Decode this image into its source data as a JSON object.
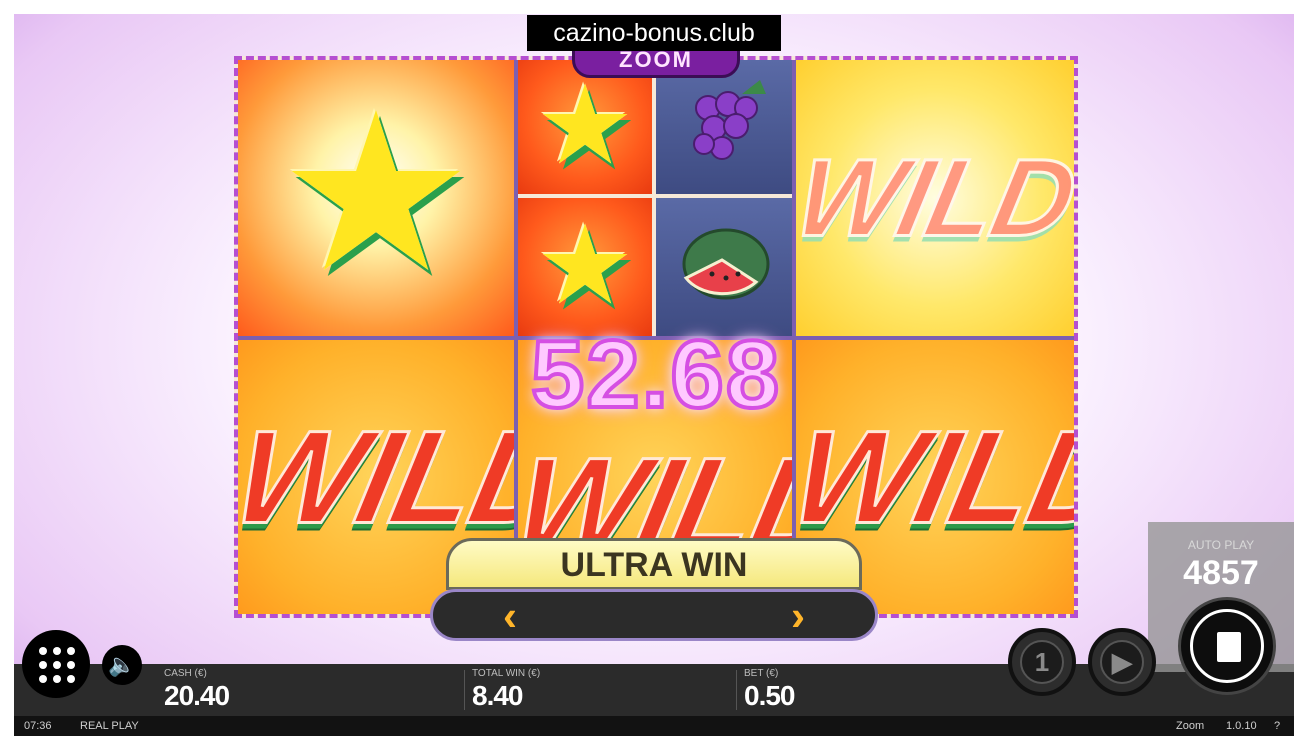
{
  "watermark": "cazino-bonus.club",
  "game_logo": "ZOOM",
  "win": {
    "amount": "52.68",
    "banner": "ULTRA WIN"
  },
  "reels": {
    "wild_label": "WILD"
  },
  "autoplay": {
    "label": "AUTO PLAY",
    "value": "4857"
  },
  "stats": {
    "cash_label": "CASH (€)",
    "cash_value": "20.40",
    "total_win_label": "TOTAL WIN (€)",
    "total_win_value": "8.40",
    "bet_label": "BET (€)",
    "bet_value": "0.50"
  },
  "controls": {
    "coin_value": "1"
  },
  "status_bar": {
    "time": "07:36",
    "mode": "REAL PLAY",
    "game_name": "Zoom",
    "version": "1.0.10"
  },
  "icons": {
    "menu": "menu-grid-icon",
    "sound": "speaker-icon",
    "coin": "coin-value-icon",
    "turbo": "turbo-play-icon",
    "spin": "spin-icon",
    "help": "help-icon",
    "arrow_left": "chevron-left-icon",
    "arrow_right": "chevron-right-icon"
  },
  "colors": {
    "reel_border": "#b54fd1",
    "win_text": "#ffc9ff",
    "wild_red": "#ef3b26",
    "arrow_gold": "#ffb52a",
    "bar_dark": "#2b2b2b"
  }
}
